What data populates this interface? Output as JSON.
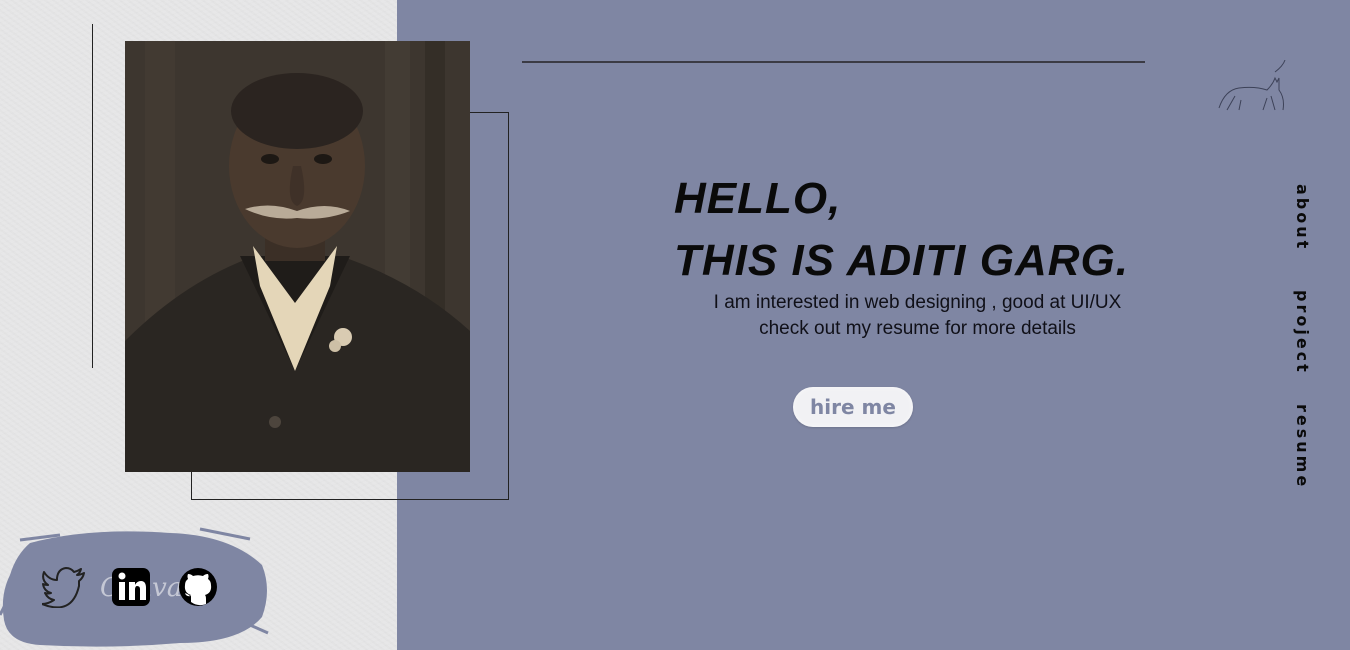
{
  "hero": {
    "line1": "HELLO,",
    "line2": "THIS IS ADITI GARG.",
    "desc_line1": "I am interested in web designing , good at UI/UX",
    "desc_line2": "check out my resume for more details",
    "button_label": "hire me"
  },
  "nav": {
    "items": [
      {
        "label": "about"
      },
      {
        "label": "project"
      },
      {
        "label": "resume"
      }
    ]
  },
  "social": {
    "items": [
      {
        "icon": "twitter-icon"
      },
      {
        "icon": "linkedin-icon"
      },
      {
        "icon": "github-icon"
      }
    ],
    "watermark": "Canva"
  },
  "colors": {
    "left_background": "#e7e7e8",
    "right_background": "#7f86a3",
    "accent_button_text": "#7f86a3",
    "text": "#0a0a0a"
  }
}
